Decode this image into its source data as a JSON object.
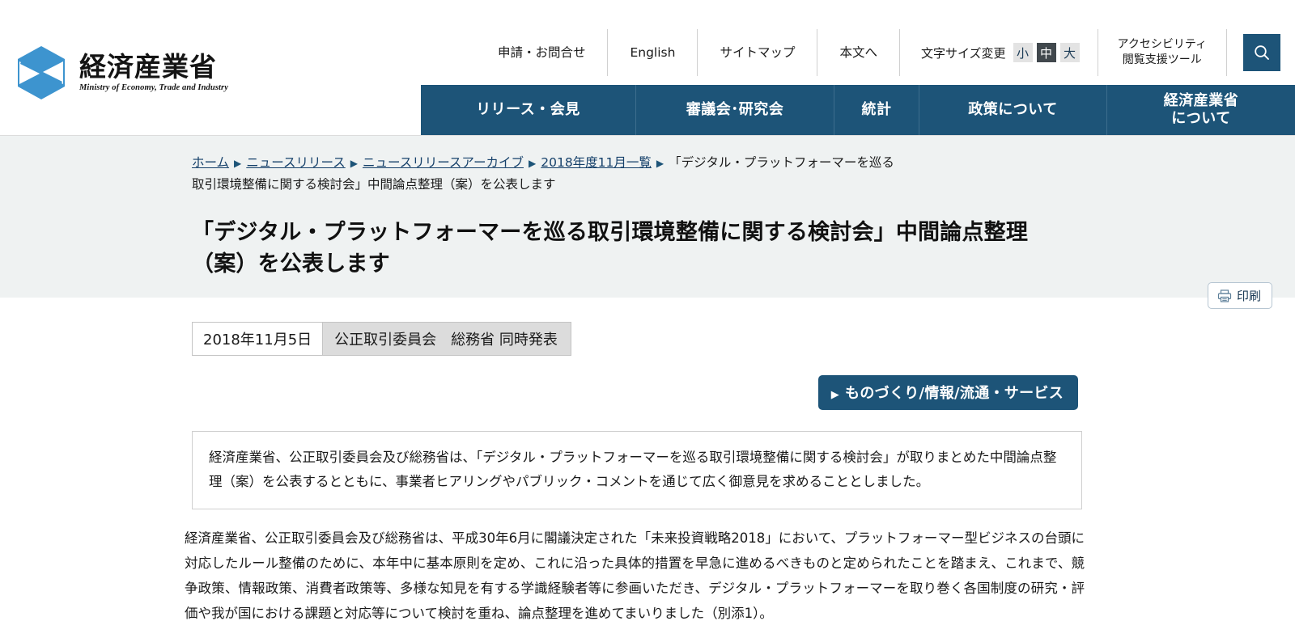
{
  "header": {
    "logo": {
      "icon": "meti-hexagon-logo",
      "jp": "経済産業省",
      "en": "Ministry of Economy, Trade and Industry",
      "color": "#3d94cf"
    },
    "utility": [
      {
        "label": "申請・お問合せ"
      },
      {
        "label": "English"
      },
      {
        "label": "サイトマップ"
      },
      {
        "label": "本文へ"
      }
    ],
    "fontsize": {
      "label": "文字サイズ変更",
      "options": [
        {
          "label": "小",
          "active": false
        },
        {
          "label": "中",
          "active": true
        },
        {
          "label": "大",
          "active": false
        }
      ]
    },
    "accessibility": {
      "line1": "アクセシビリティ",
      "line2": "閲覧支援ツール"
    },
    "search": {
      "icon": "search-icon",
      "color": "#1d5478"
    },
    "nav": [
      {
        "label": "リリース・会見"
      },
      {
        "label": "審議会･研究会"
      },
      {
        "label": "統計"
      },
      {
        "label": "政策について"
      },
      {
        "label": "経済産業省\nについて",
        "line1": "経済産業省",
        "line2": "について"
      }
    ],
    "nav_color": "#1d5478"
  },
  "breadcrumb": {
    "items": [
      {
        "label": "ホーム",
        "link": true
      },
      {
        "label": "ニュースリリース",
        "link": true
      },
      {
        "label": "ニュースリリースアーカイブ",
        "link": true
      },
      {
        "label": "2018年度11月一覧",
        "link": true
      },
      {
        "label": "「デジタル・プラットフォーマーを巡る取引環境整備に関する検討会」中間論点整理（案）を公表します",
        "link": false
      }
    ],
    "separator": "▶"
  },
  "print_button": {
    "label": "印刷",
    "icon": "printer-icon"
  },
  "page_title": "「デジタル・プラットフォーマーを巡る取引環境整備に関する検討会」中間論点整理（案）を公表します",
  "meta": {
    "date": "2018年11月5日",
    "agency": "公正取引委員会　総務省 同時発表"
  },
  "category_tag": {
    "arrow": "▶",
    "label": "ものづくり/情報/流通・サービス"
  },
  "summary": "経済産業省、公正取引委員会及び総務省は、「デジタル・プラットフォーマーを巡る取引環境整備に関する検討会」が取りまとめた中間論点整理（案）を公表するとともに、事業者ヒアリングやパブリック・コメントを通じて広く御意見を求めることとしました。",
  "body_paragraph": "経済産業省、公正取引委員会及び総務省は、平成30年6月に閣議決定された「未来投資戦略2018」において、プラットフォーマー型ビジネスの台頭に対応したルール整備のために、本年中に基本原則を定め、これに沿った具体的措置を早急に進めるべきものと定められたことを踏まえ、これまで、競争政策、情報政策、消費者政策等、多様な知見を有する学識経験者等に参画いただき、デジタル・プラットフォーマーを取り巻く各国制度の研究・評価や我が国における課題と対応等について検討を重ね、論点整理を進めてまいりました（別添1）。"
}
